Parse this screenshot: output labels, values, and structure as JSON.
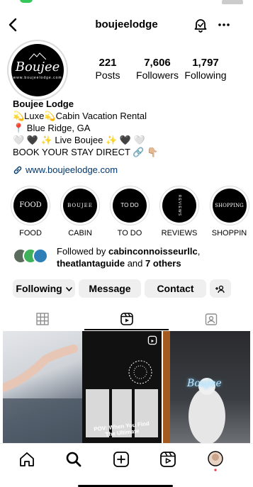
{
  "profile": {
    "username": "boujeelodge",
    "display_name": "Boujee Lodge",
    "avatar_logo": "Boujee",
    "avatar_sub": "www.boujeelodge.com"
  },
  "stats": [
    {
      "value": "221",
      "label": "Posts"
    },
    {
      "value": "7,606",
      "label": "Followers"
    },
    {
      "value": "1,797",
      "label": "Following"
    }
  ],
  "bio": [
    "💫Luxe💫Cabin Vacation Rental",
    "📍 Blue Ridge, GA",
    "🤍 🖤 ✨ Live Boujee ✨ 🖤 🤍",
    "BOOK YOUR STAY DIRECT 🔗 👇🏼"
  ],
  "website": "www.boujeelodge.com",
  "highlights": [
    {
      "label": "FOOD",
      "cover": "FOOD"
    },
    {
      "label": "CABIN",
      "cover": "BOUJEE"
    },
    {
      "label": "TO DO",
      "cover": "TO DO"
    },
    {
      "label": "REVIEWS",
      "cover": "REVIEWS"
    },
    {
      "label": "SHOPPIN",
      "cover": "SHOPPING"
    }
  ],
  "followed_by": {
    "prefix": "Followed by ",
    "user1": "cabinconnoisseurllc",
    "sep": ",",
    "user2": "theatlantaguide",
    "mid": " and ",
    "others": "7 others"
  },
  "actions": {
    "following": "Following",
    "message": "Message",
    "contact": "Contact"
  },
  "grid_posts": [
    {
      "caption": ""
    },
    {
      "caption": "POV: When You Find The Ultimate"
    },
    {
      "caption": "Boujee"
    }
  ],
  "icons": {
    "back": "back-arrow-icon",
    "bell": "notification-bell-icon",
    "more": "more-options-icon",
    "link": "link-icon",
    "add_person": "add-person-icon",
    "grid_tab": "grid-icon",
    "reels_tab": "reels-icon",
    "tagged_tab": "tagged-icon",
    "home": "home-icon",
    "search": "search-icon",
    "create": "create-icon",
    "reels_nav": "reels-icon",
    "profile": "profile-avatar-icon"
  },
  "colors": {
    "link": "#00376b",
    "button_bg": "#efefef",
    "status_green": "#34c759",
    "notification_dot": "#ff3040"
  }
}
